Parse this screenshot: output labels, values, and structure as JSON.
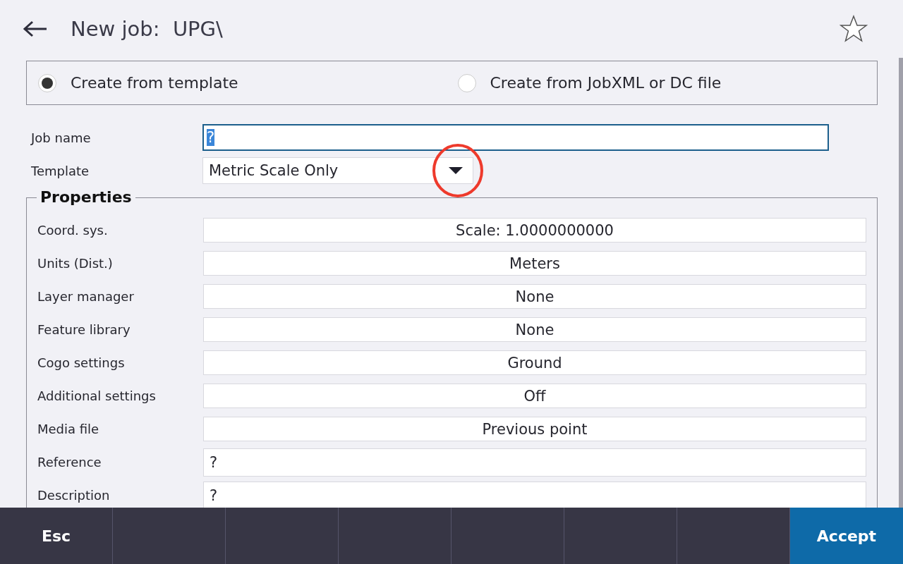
{
  "header": {
    "title": "New job:  UPG\\",
    "favorite": false
  },
  "source_options": [
    {
      "label": "Create from template",
      "selected": true
    },
    {
      "label": "Create from JobXML or DC file",
      "selected": false
    }
  ],
  "job_name": {
    "label": "Job name",
    "value": "?",
    "text_selected": true
  },
  "template": {
    "label": "Template",
    "value": "Metric Scale Only"
  },
  "properties": {
    "title": "Properties",
    "rows": [
      {
        "label": "Coord. sys.",
        "value": "Scale:  1.0000000000",
        "kind": "choice"
      },
      {
        "label": "Units (Dist.)",
        "value": "Meters",
        "kind": "choice"
      },
      {
        "label": "Layer manager",
        "value": "None",
        "kind": "choice"
      },
      {
        "label": "Feature library",
        "value": "None",
        "kind": "choice"
      },
      {
        "label": "Cogo settings",
        "value": "Ground",
        "kind": "choice"
      },
      {
        "label": "Additional settings",
        "value": "Off",
        "kind": "choice"
      },
      {
        "label": "Media file",
        "value": "Previous point",
        "kind": "choice"
      },
      {
        "label": "Reference",
        "value": "?",
        "kind": "text"
      },
      {
        "label": "Description",
        "value": "?",
        "kind": "text"
      }
    ]
  },
  "softkeys": [
    {
      "kind": "plain",
      "label": "Esc"
    },
    {
      "kind": "empty"
    },
    {
      "kind": "empty"
    },
    {
      "kind": "empty"
    },
    {
      "kind": "empty"
    },
    {
      "kind": "empty"
    },
    {
      "kind": "empty"
    },
    {
      "kind": "primary",
      "label": "Accept"
    }
  ]
}
